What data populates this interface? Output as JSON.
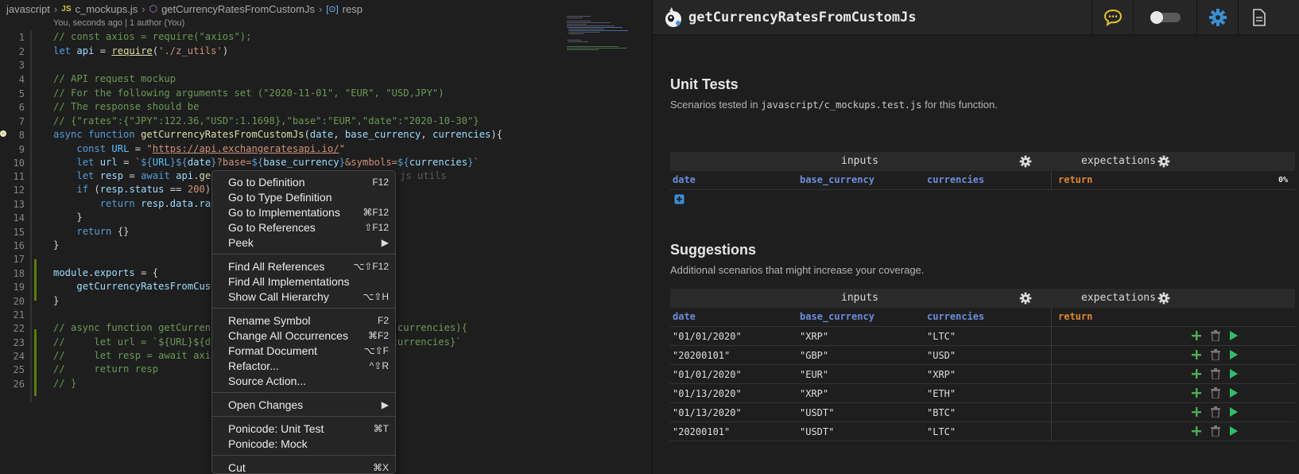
{
  "breadcrumb": {
    "folder": "javascript",
    "js_badge": "JS",
    "file": "c_mockups.js",
    "function": "getCurrencyRatesFromCustomJs",
    "variable": "resp"
  },
  "codelens": "You, seconds ago | 1 author (You)",
  "line_numbers": [
    "1",
    "2",
    "3",
    "4",
    "5",
    "6",
    "7",
    "8",
    "9",
    "10",
    "11",
    "12",
    "13",
    "14",
    "15",
    "16",
    "17",
    "18",
    "19",
    "20",
    "21",
    "22",
    "23",
    "24",
    "25",
    "26"
  ],
  "ghost_hint": "D] js utils",
  "context_menu": {
    "items": [
      {
        "label": "Go to Definition",
        "shortcut": "F12"
      },
      {
        "label": "Go to Type Definition",
        "shortcut": ""
      },
      {
        "label": "Go to Implementations",
        "shortcut": "⌘F12"
      },
      {
        "label": "Go to References",
        "shortcut": "⇧F12"
      },
      {
        "label": "Peek",
        "shortcut": "▶"
      },
      {
        "label": "Find All References",
        "shortcut": "⌥⇧F12"
      },
      {
        "label": "Find All Implementations",
        "shortcut": ""
      },
      {
        "label": "Show Call Hierarchy",
        "shortcut": "⌥⇧H"
      },
      {
        "label": "Rename Symbol",
        "shortcut": "F2"
      },
      {
        "label": "Change All Occurrences",
        "shortcut": "⌘F2"
      },
      {
        "label": "Format Document",
        "shortcut": "⌥⇧F"
      },
      {
        "label": "Refactor...",
        "shortcut": "^⇧R"
      },
      {
        "label": "Source Action...",
        "shortcut": ""
      },
      {
        "label": "Open Changes",
        "shortcut": "▶"
      },
      {
        "label": "Ponicode: Unit Test",
        "shortcut": "⌘T"
      },
      {
        "label": "Ponicode: Mock",
        "shortcut": ""
      },
      {
        "label": "Cut",
        "shortcut": "⌘X"
      }
    ]
  },
  "panel": {
    "title": "getCurrencyRatesFromCustomJs",
    "unit_tests": {
      "heading": "Unit Tests",
      "sub_prefix": "Scenarios tested in ",
      "sub_file": "javascript/c_mockups.test.js",
      "sub_suffix": " for this function.",
      "inputs_label": "inputs",
      "expectations_label": "expectations",
      "cols": [
        "date",
        "base_currency",
        "currencies"
      ],
      "return_label": "return",
      "coverage": "0%"
    },
    "suggestions": {
      "heading": "Suggestions",
      "sub": "Additional scenarios that might increase your coverage.",
      "inputs_label": "inputs",
      "expectations_label": "expectations",
      "cols": [
        "date",
        "base_currency",
        "currencies"
      ],
      "return_label": "return",
      "rows": [
        {
          "date": "\"01/01/2020\"",
          "base": "\"XRP\"",
          "cur": "\"LTC\""
        },
        {
          "date": "\"20200101\"",
          "base": "\"GBP\"",
          "cur": "\"USD\""
        },
        {
          "date": "\"01/01/2020\"",
          "base": "\"EUR\"",
          "cur": "\"XRP\""
        },
        {
          "date": "\"01/13/2020\"",
          "base": "\"XRP\"",
          "cur": "\"ETH\""
        },
        {
          "date": "\"01/13/2020\"",
          "base": "\"USDT\"",
          "cur": "\"BTC\""
        },
        {
          "date": "\"20200101\"",
          "base": "\"USDT\"",
          "cur": "\"LTC\""
        }
      ]
    }
  },
  "colors": {
    "accent": "#3a8fd6",
    "add": "#4caf50",
    "run": "#2ebf6b",
    "output": "#e0862c",
    "input": "#6c8ddc"
  }
}
